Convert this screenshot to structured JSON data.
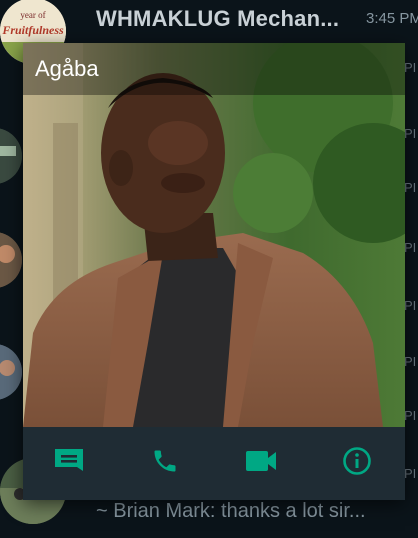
{
  "colors": {
    "accent": "#00a884",
    "background": "#0b141a",
    "popup_actions_bg": "#1f2c34",
    "muted_text": "#8696a0"
  },
  "chat_list": {
    "top_row": {
      "title": "WHMAKLUG Mechan...",
      "time": "3:45 PM",
      "avatar_badge_line1": "year of",
      "avatar_badge_line2": "Fruitfulness"
    },
    "partial_times": [
      "PI",
      "PI",
      "PI",
      "PI",
      "PI",
      "PI",
      "PI",
      "PI"
    ],
    "bottom_row": {
      "preview": "~ Brian Mark: thanks a lot sir..."
    }
  },
  "profile_popup": {
    "contact_name": "Agåba",
    "actions": [
      {
        "name": "message",
        "icon": "message-icon"
      },
      {
        "name": "call",
        "icon": "phone-icon"
      },
      {
        "name": "video-call",
        "icon": "video-icon"
      },
      {
        "name": "info",
        "icon": "info-icon"
      }
    ]
  }
}
